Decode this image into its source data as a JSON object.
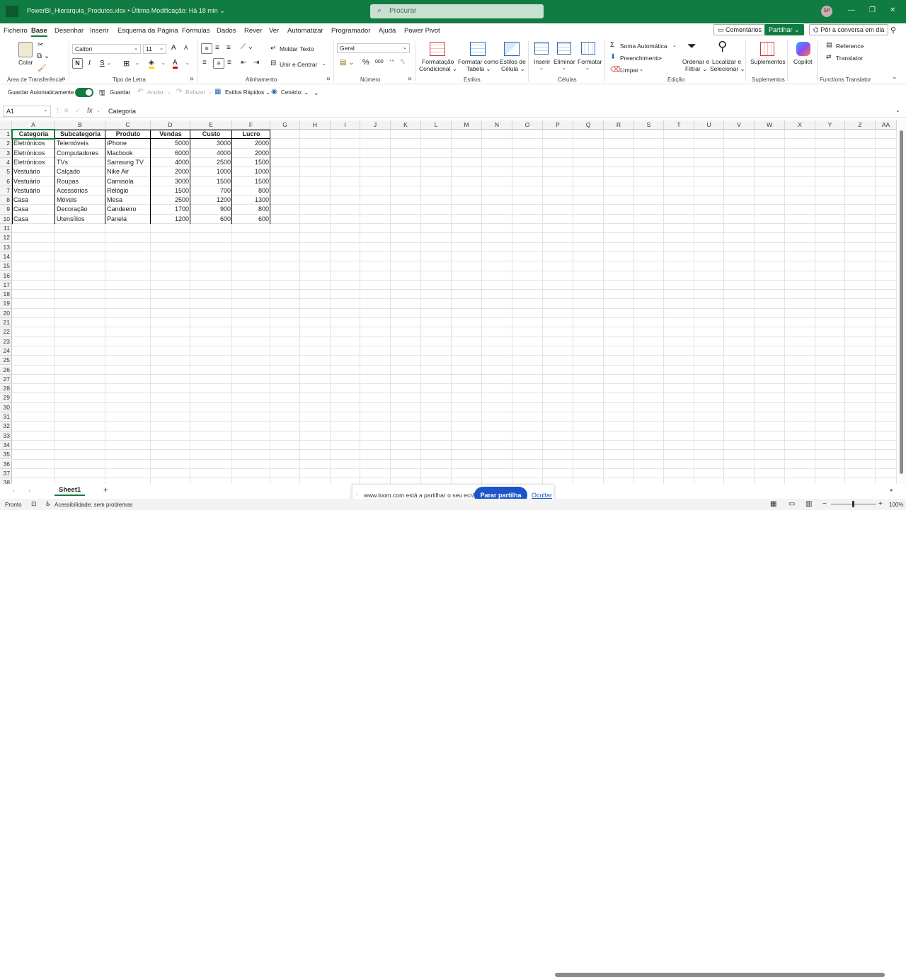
{
  "titlebar": {
    "document_title": "PowerBI_Hierarquia_Produtos.xlsx  •  Última Modificação: Há 18 min ⌄",
    "search_placeholder": "Procurar",
    "user_initials": "SP"
  },
  "menu": {
    "items": [
      "Ficheiro",
      "Base",
      "Desenhar",
      "Inserir",
      "Esquema da Página",
      "Fórmulas",
      "Dados",
      "Rever",
      "Ver",
      "Automatizar",
      "Programador",
      "Ajuda",
      "Power Pivot"
    ],
    "active": "Base",
    "comments": "Comentários",
    "share": "Partilhar ⌄",
    "chat": "Pôr a conversa em dia"
  },
  "ribbon": {
    "groups": {
      "clipboard": "Área de Transferência",
      "font": "Tipo de Letra",
      "alignment": "Alinhamento",
      "number": "Número",
      "styles": "Estilos",
      "cells": "Células",
      "editing": "Edição",
      "addins": "Suplementos",
      "translator": "Functions Translator"
    },
    "paste": "Colar",
    "font_name": "Calibri",
    "font_size": "11",
    "bold": "N",
    "italic": "I",
    "underline": "S",
    "wrap_text": "Moldar Texto",
    "merge_center": "Unir e Centrar",
    "number_format": "Geral",
    "cond_format": [
      "Formatação",
      "Condicional ⌄"
    ],
    "format_table": [
      "Formatar como",
      "Tabela ⌄"
    ],
    "cell_styles": [
      "Estilos de",
      "Célula ⌄"
    ],
    "insert": "Inserir",
    "delete": "Eliminar",
    "format": "Formatar",
    "autosum": "Soma Automática",
    "fill": "Preenchimento",
    "clear": "Limpar",
    "sort_filter": [
      "Ordenar e",
      "Filtrar ⌄"
    ],
    "find_select": [
      "Localizar e",
      "Selecionar ⌄"
    ],
    "addins_btn": "Suplementos",
    "copilot": "Copilot",
    "reference": "Reference",
    "translator_btn": "Translator"
  },
  "qat": {
    "autosave": "Guardar Automaticamente",
    "save": "Guardar",
    "undo": "Anular",
    "redo": "Refazer",
    "quick_styles": "Estilos Rápidos ⌄",
    "scenario": "Cenário: ⌄"
  },
  "formula_bar": {
    "name_box": "A1",
    "fx": "fx",
    "content": "Categoria"
  },
  "sheet": {
    "columns": [
      "A",
      "B",
      "C",
      "D",
      "E",
      "F",
      "G",
      "H",
      "I",
      "J",
      "K",
      "L",
      "M",
      "N",
      "O",
      "P",
      "Q",
      "R",
      "S",
      "T",
      "U",
      "V",
      "W",
      "X",
      "Y",
      "Z",
      "AA"
    ],
    "row_count": 38,
    "headers": [
      "Categoria",
      "Subcategoria",
      "Produto",
      "Vendas",
      "Custo",
      "Lucro"
    ],
    "rows": [
      [
        "Eletrónicos",
        "Telemóveis",
        "iPhone",
        "5000",
        "3000",
        "2000"
      ],
      [
        "Eletrónicos",
        "Computadores",
        "Macbook",
        "6000",
        "4000",
        "2000"
      ],
      [
        "Eletrónicos",
        "TVs",
        "Samsung TV",
        "4000",
        "2500",
        "1500"
      ],
      [
        "Vestuário",
        "Calçado",
        "Nike Air",
        "2000",
        "1000",
        "1000"
      ],
      [
        "Vestuário",
        "Roupas",
        "Camisola",
        "3000",
        "1500",
        "1500"
      ],
      [
        "Vestuário",
        "Acessórios",
        "Relógio",
        "1500",
        "700",
        "800"
      ],
      [
        "Casa",
        "Móveis",
        "Mesa",
        "2500",
        "1200",
        "1300"
      ],
      [
        "Casa",
        "Decoração",
        "Candeeiro",
        "1700",
        "900",
        "800"
      ],
      [
        "Casa",
        "Utensílios",
        "Panela",
        "1200",
        "600",
        "600"
      ]
    ]
  },
  "tabs": {
    "sheet_name": "Sheet1",
    "add": "+"
  },
  "loom": {
    "message": "www.loom.com está a partilhar o seu ecrã.",
    "stop": "Parar partilha",
    "hide": "Ocultar"
  },
  "status": {
    "ready": "Pronto",
    "accessibility": "Acessibilidade: sem problemas",
    "zoom": "100%"
  },
  "colors": {
    "accent": "#107c41",
    "loom_blue": "#1b55c9"
  }
}
